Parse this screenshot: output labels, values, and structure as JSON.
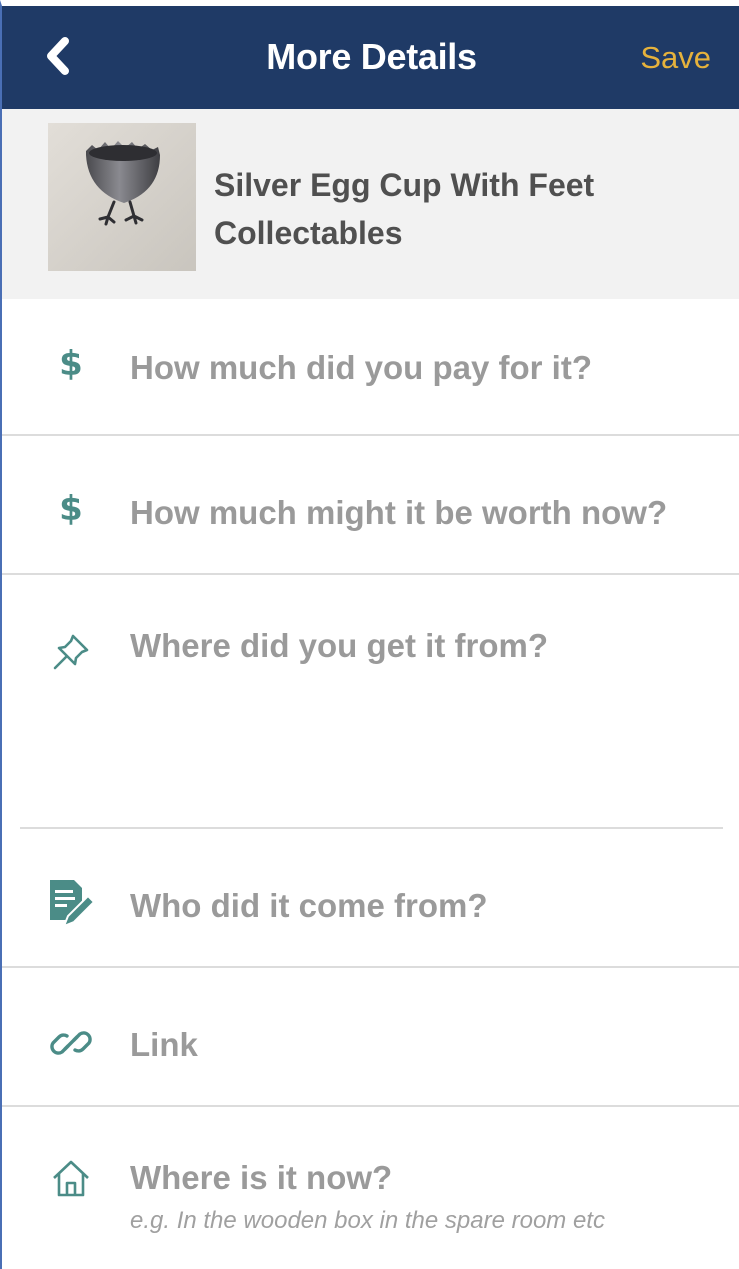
{
  "nav": {
    "title": "More Details",
    "save_label": "Save",
    "back_icon": "chevron-left-icon"
  },
  "item": {
    "name": "Silver Egg Cup With Feet",
    "category": "Collectables"
  },
  "fields": {
    "paid": {
      "icon": "dollar-icon",
      "glyph": "$",
      "placeholder": "How much did you pay for it?"
    },
    "worth": {
      "icon": "dollar-icon",
      "glyph": "$",
      "placeholder": "How much might it be worth now?"
    },
    "source": {
      "icon": "pin-icon",
      "placeholder": "Where did you get it from?"
    },
    "giver": {
      "icon": "note-pen-icon",
      "placeholder": "Who did it come from?"
    },
    "link": {
      "icon": "link-icon",
      "placeholder": "Link"
    },
    "location": {
      "icon": "home-icon",
      "placeholder": "Where is it now?",
      "hint": "e.g. In the wooden box in the spare room etc"
    }
  },
  "colors": {
    "navbar": "#1f3a66",
    "save": "#e6b23c",
    "icon_teal": "#4b8c87",
    "placeholder": "#9a9a9a"
  }
}
